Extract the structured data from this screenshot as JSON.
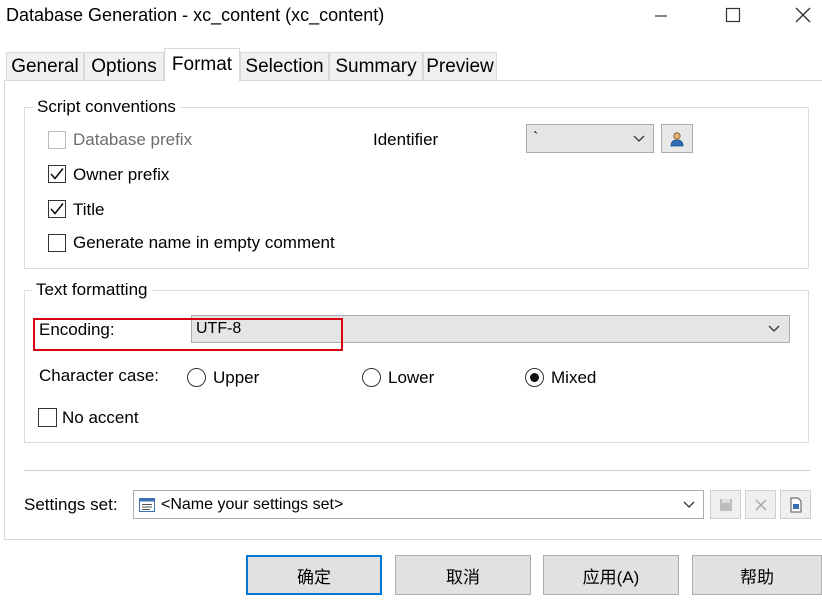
{
  "window": {
    "title": "Database Generation - xc_content (xc_content)"
  },
  "tabs": [
    {
      "label": "General"
    },
    {
      "label": "Options"
    },
    {
      "label": "Format",
      "active": true
    },
    {
      "label": "Selection"
    },
    {
      "label": "Summary"
    },
    {
      "label": "Preview"
    }
  ],
  "script_conventions": {
    "legend": "Script conventions",
    "database_prefix": {
      "label": "Database prefix",
      "checked": false,
      "enabled": false
    },
    "owner_prefix": {
      "label": "Owner prefix",
      "checked": true
    },
    "title": {
      "label": "Title",
      "checked": true
    },
    "generate_name": {
      "label": "Generate name in empty comment",
      "checked": false
    },
    "identifier_label": "Identifier",
    "identifier_value": "`"
  },
  "text_formatting": {
    "legend": "Text formatting",
    "encoding_label": "Encoding:",
    "encoding_value": "UTF-8",
    "character_case_label": "Character case:",
    "case_options": [
      {
        "label": "Upper",
        "selected": false
      },
      {
        "label": "Lower",
        "selected": false
      },
      {
        "label": "Mixed",
        "selected": true
      }
    ],
    "no_accent": {
      "label": "No accent",
      "checked": false
    },
    "highlight_color": "#d9000f"
  },
  "settings_set": {
    "label": "Settings set:",
    "value": "<Name your settings set>"
  },
  "buttons": {
    "ok": "确定",
    "cancel": "取消",
    "apply": "应用(A)",
    "help": "帮助"
  },
  "colors": {
    "accent": "#0078d7"
  }
}
